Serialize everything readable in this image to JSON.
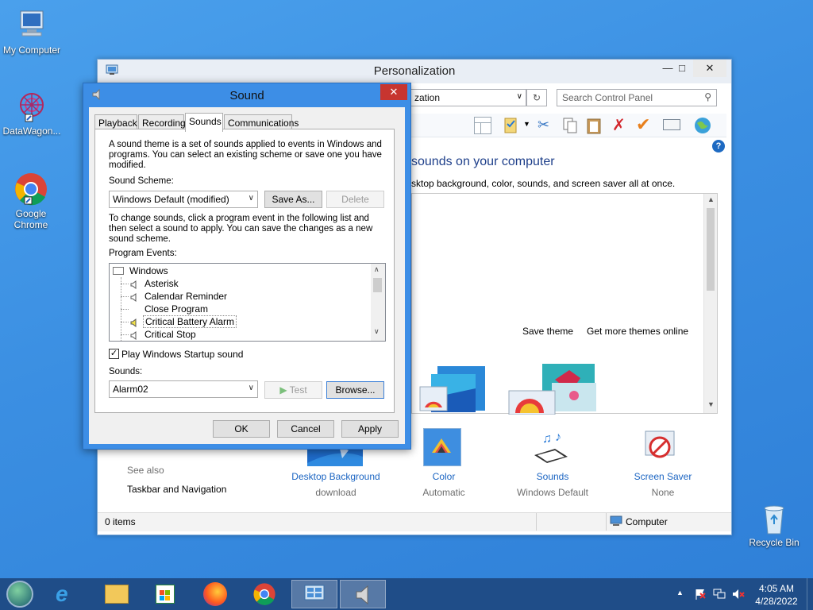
{
  "desktop": {
    "icons": [
      {
        "label": "My Computer"
      },
      {
        "label": "DataWagon..."
      },
      {
        "label": "Google Chrome"
      },
      {
        "label": "Recycle Bin"
      }
    ]
  },
  "personalization": {
    "title": "Personalization",
    "address": "zation",
    "search_placeholder": "Search Control Panel",
    "heading": "sounds on your computer",
    "subheading": "sktop background, color, sounds, and screen saver all at once.",
    "save_theme": "Save theme",
    "get_more_themes": "Get more themes online",
    "see_also": "See also",
    "taskbar_nav": "Taskbar and Navigation",
    "bottom_items": [
      {
        "label": "Desktop Background",
        "sub": "download"
      },
      {
        "label": "Color",
        "sub": "Automatic"
      },
      {
        "label": "Sounds",
        "sub": "Windows Default"
      },
      {
        "label": "Screen Saver",
        "sub": "None"
      }
    ],
    "status_left": "0 items",
    "status_right": "Computer"
  },
  "sound_dialog": {
    "title": "Sound",
    "tabs": [
      "Playback",
      "Recording",
      "Sounds",
      "Communications"
    ],
    "active_tab": "Sounds",
    "intro": "A sound theme is a set of sounds applied to events in Windows and programs.  You can select an existing scheme or save one you have modified.",
    "scheme_label": "Sound Scheme:",
    "scheme_value": "Windows Default (modified)",
    "save_as": "Save As...",
    "delete": "Delete",
    "instructions": "To change sounds, click a program event in the following list and then select a sound to apply.  You can save the changes as a new sound scheme.",
    "events_label": "Program Events:",
    "events": [
      {
        "label": "Windows",
        "level": 0
      },
      {
        "label": "Asterisk",
        "level": 1
      },
      {
        "label": "Calendar Reminder",
        "level": 1
      },
      {
        "label": "Close Program",
        "level": 1
      },
      {
        "label": "Critical Battery Alarm",
        "level": 1
      },
      {
        "label": "Critical Stop",
        "level": 1
      }
    ],
    "selected_event": "Critical Battery Alarm",
    "startup_label": "Play Windows Startup sound",
    "startup_checked": true,
    "sounds_label": "Sounds:",
    "sound_value": "Alarm02",
    "test": "Test",
    "browse": "Browse...",
    "ok": "OK",
    "cancel": "Cancel",
    "apply": "Apply"
  },
  "taskbar": {
    "time": "4:05 AM",
    "date": "4/28/2022"
  }
}
